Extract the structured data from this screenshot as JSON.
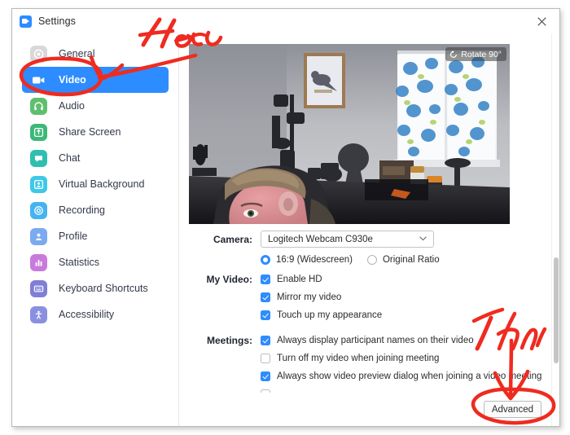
{
  "window": {
    "title": "Settings",
    "logo_icon": "zoom-camera-icon",
    "close_icon": "close-icon"
  },
  "sidebar": {
    "items": [
      {
        "label": "General",
        "icon": "gear-icon",
        "color": "#d8d8d8",
        "active": false
      },
      {
        "label": "Video",
        "icon": "video-camera-icon",
        "color": "#ffffff",
        "active": true
      },
      {
        "label": "Audio",
        "icon": "headphones-icon",
        "color": "#5fbf6e",
        "active": false
      },
      {
        "label": "Share Screen",
        "icon": "share-screen-icon",
        "color": "#3cb878",
        "active": false
      },
      {
        "label": "Chat",
        "icon": "chat-bubble-icon",
        "color": "#2fbfb0",
        "active": false
      },
      {
        "label": "Virtual Background",
        "icon": "person-frame-icon",
        "color": "#3ec8e8",
        "active": false
      },
      {
        "label": "Recording",
        "icon": "record-circle-icon",
        "color": "#45b3f0",
        "active": false
      },
      {
        "label": "Profile",
        "icon": "person-icon",
        "color": "#7aaaf0",
        "active": false
      },
      {
        "label": "Statistics",
        "icon": "bar-chart-icon",
        "color": "#c87bdb",
        "active": false
      },
      {
        "label": "Keyboard Shortcuts",
        "icon": "keyboard-icon",
        "color": "#7f7fd8",
        "active": false
      },
      {
        "label": "Accessibility",
        "icon": "accessibility-icon",
        "color": "#8a90e0",
        "active": false
      }
    ]
  },
  "preview": {
    "rotate_label": "Rotate 90°",
    "rotate_icon": "rotate-icon"
  },
  "form": {
    "camera": {
      "label": "Camera:",
      "selected": "Logitech Webcam C930e",
      "chevron_icon": "chevron-down-icon"
    },
    "aspect": {
      "options": [
        {
          "label": "16:9 (Widescreen)",
          "selected": true
        },
        {
          "label": "Original Ratio",
          "selected": false
        }
      ]
    },
    "my_video": {
      "label": "My Video:",
      "options": [
        {
          "label": "Enable HD",
          "checked": true
        },
        {
          "label": "Mirror my video",
          "checked": true
        },
        {
          "label": "Touch up my appearance",
          "checked": true
        }
      ]
    },
    "meetings": {
      "label": "Meetings:",
      "options": [
        {
          "label": "Always display participant names on their video",
          "checked": true
        },
        {
          "label": "Turn off my video when joining meeting",
          "checked": false
        },
        {
          "label": "Always show video preview dialog when joining a video meeting",
          "checked": true
        }
      ]
    },
    "advanced_label": "Advanced"
  },
  "annotations": [
    {
      "name": "here-annotation",
      "text": "Here",
      "color": "#ef2b20"
    },
    {
      "name": "then-annotation",
      "text": "Then",
      "color": "#ef2b20"
    }
  ],
  "colors": {
    "accent": "#2d8cff",
    "annotation_red": "#ef2b20",
    "text": "#2b2b2b"
  }
}
